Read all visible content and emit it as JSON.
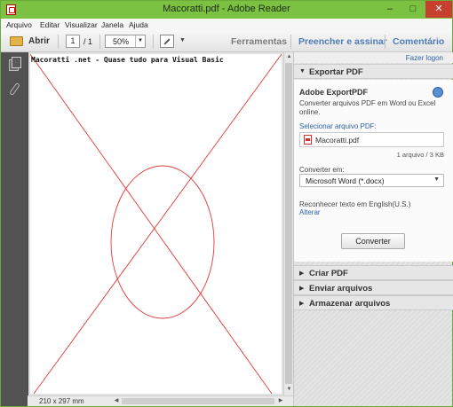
{
  "window": {
    "title": "Macoratti.pdf - Adobe Reader",
    "controls": {
      "minimize": "–",
      "maximize": "□",
      "close": "✕"
    }
  },
  "menu": [
    "Arquivo",
    "Editar",
    "Visualizar",
    "Janela",
    "Ajuda"
  ],
  "toolbar": {
    "open_label": "Abrir",
    "current_page": "1",
    "page_total": "/ 1",
    "zoom": "50%",
    "zoom_arrow": "▼",
    "more_arrow": "▼",
    "tools": "Ferramentas",
    "fill_sign": "Preencher e assinar",
    "comment": "Comentário"
  },
  "document": {
    "heading": "Macoratti .net - Quase tudo para Visual  Basic",
    "page_size": "210 x 297 mm"
  },
  "scroll_arrows": {
    "up": "▲",
    "down": "▼",
    "left": "◀",
    "right": "▶"
  },
  "right_panel": {
    "login": "Fazer logon",
    "export": {
      "header": "Exportar PDF",
      "expanded_glyph": "▼",
      "title": "Adobe ExportPDF",
      "description": "Converter arquivos PDF em Word ou Excel online.",
      "select_label": "Selecionar arquivo PDF:",
      "file_name": "Macoratti.pdf",
      "file_count": "1 arquivo / 3 KB",
      "convert_to_label": "Converter em:",
      "format": "Microsoft Word (*.docx)",
      "format_arrow": "▼",
      "ocr_label": "Reconhecer texto em English(U.S.)",
      "ocr_change": "Alterar",
      "convert_button": "Converter"
    },
    "collapsed_glyph": "▶",
    "sections": [
      "Criar PDF",
      "Enviar arquivos",
      "Armazenar arquivos"
    ]
  },
  "colors": {
    "title_bar": "#7cc242",
    "close_button": "#c7402f",
    "drawing": "#e23a3a",
    "link": "#2b5fa6"
  }
}
